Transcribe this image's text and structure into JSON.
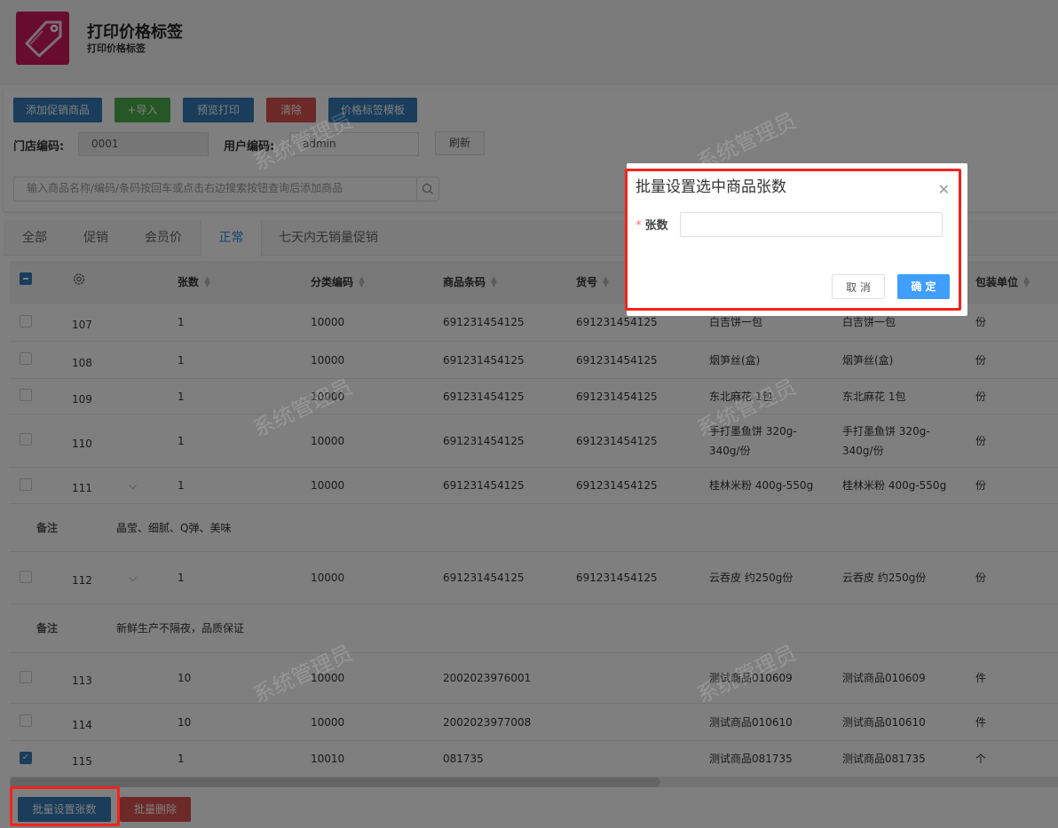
{
  "header": {
    "title": "打印价格标签",
    "subtitle": "打印价格标签"
  },
  "toolbar": {
    "add_promo": "添加促销商品",
    "import": "+导入",
    "preview_print": "预览打印",
    "clear": "清除",
    "template": "价格标签模板",
    "refresh": "刷新"
  },
  "filters": {
    "store_code_label": "门店编码:",
    "store_code_value": "0001",
    "user_code_label": "用户编码:",
    "user_code_value": "admin",
    "search_placeholder": "输入商品名称/编码/条码按回车或点击右边搜索按钮查询后添加商品"
  },
  "tabs": [
    "全部",
    "促销",
    "会员价",
    "正常",
    "七天内无销量促销"
  ],
  "active_tab": "正常",
  "table": {
    "headers": {
      "qty": "张数",
      "category": "分类编码",
      "barcode": "商品条码",
      "item_no": "货号",
      "unit": "包装单位"
    },
    "note_label": "备注",
    "rows": [
      {
        "type": "row",
        "checked": false,
        "idx": "107",
        "qty": "1",
        "category": "10000",
        "barcode": "691231454125",
        "item_no": "691231454125",
        "name1": "白吉饼一包",
        "name2": "白吉饼一包",
        "unit": "份"
      },
      {
        "type": "row",
        "checked": false,
        "idx": "108",
        "qty": "1",
        "category": "10000",
        "barcode": "691231454125",
        "item_no": "691231454125",
        "name1": "烟笋丝(盒)",
        "name2": "烟笋丝(盒)",
        "unit": "份"
      },
      {
        "type": "row",
        "checked": false,
        "idx": "109",
        "qty": "1",
        "category": "10000",
        "barcode": "691231454125",
        "item_no": "691231454125",
        "name1": "东北麻花 1包",
        "name2": "东北麻花 1包",
        "unit": "份"
      },
      {
        "type": "row",
        "checked": false,
        "idx": "110",
        "qty": "1",
        "category": "10000",
        "barcode": "691231454125",
        "item_no": "691231454125",
        "name1": "手打墨鱼饼 320g-340g/份",
        "name2": "手打墨鱼饼 320g-340g/份",
        "unit": "份"
      },
      {
        "type": "row",
        "checked": false,
        "idx": "111",
        "expand": true,
        "qty": "1",
        "category": "10000",
        "barcode": "691231454125",
        "item_no": "691231454125",
        "name1": "桂林米粉 400g-550g",
        "name2": "桂林米粉 400g-550g",
        "unit": "份"
      },
      {
        "type": "note",
        "text": "晶莹、细腻、Q弹、美味"
      },
      {
        "type": "row",
        "checked": false,
        "idx": "112",
        "expand": true,
        "qty": "1",
        "category": "10000",
        "barcode": "691231454125",
        "item_no": "691231454125",
        "name1": "云吞皮 约250g份",
        "name2": "云吞皮 约250g份",
        "unit": "份"
      },
      {
        "type": "note",
        "text": "新鲜生产不隔夜，品质保证"
      },
      {
        "type": "row",
        "checked": false,
        "idx": "113",
        "qty": "10",
        "category": "10000",
        "barcode": "2002023976001",
        "item_no": "",
        "name1": "测试商品010609",
        "name2": "测试商品010609",
        "unit": "件"
      },
      {
        "type": "row",
        "checked": false,
        "idx": "114",
        "qty": "10",
        "category": "10000",
        "barcode": "2002023977008",
        "item_no": "",
        "name1": "测试商品010610",
        "name2": "测试商品010610",
        "unit": "件"
      },
      {
        "type": "row",
        "checked": true,
        "idx": "115",
        "qty": "1",
        "category": "10010",
        "barcode": "081735",
        "item_no": "",
        "name1": "测试商品081735",
        "name2": "测试商品081735",
        "unit": "个"
      }
    ]
  },
  "footer": {
    "batch_set_qty": "批量设置张数",
    "batch_delete": "批量删除"
  },
  "watermark": "系统管理员",
  "dialog": {
    "title": "批量设置选中商品张数",
    "field_label": "张数",
    "field_value": "",
    "cancel": "取 消",
    "confirm": "确 定"
  },
  "colors": {
    "primary": "#337ab7",
    "success": "#4cae4c",
    "danger": "#d9534f",
    "accent": "#409eff",
    "highlight": "#f5221b"
  }
}
